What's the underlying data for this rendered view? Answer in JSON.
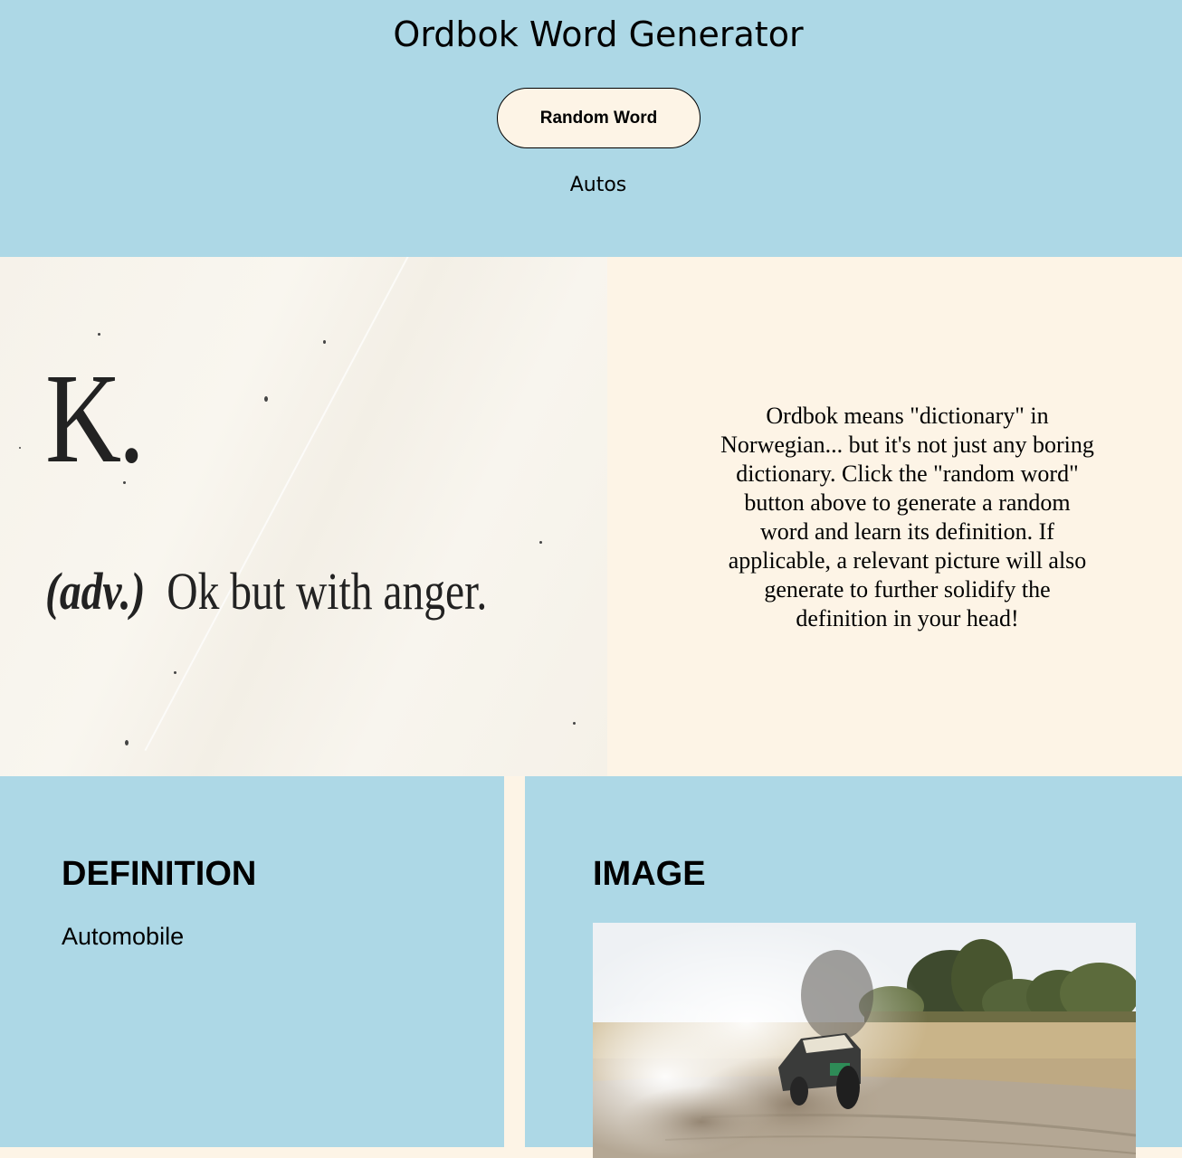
{
  "header": {
    "title": "Ordbok Word Generator",
    "button_label": "Random Word",
    "current_word": "Autos"
  },
  "hero": {
    "image": {
      "letter": "K.",
      "part_of_speech": "(adv.)",
      "definition": "Ok but with anger."
    },
    "description": "Ordbok means \"dictionary\" in Norwegian... but it's not just any boring dictionary. Click the \"random word\" button above to generate a random word and learn its definition. If applicable, a relevant picture will also generate to further solidify the definition in your head!"
  },
  "definition_panel": {
    "heading": "DEFINITION",
    "text": "Automobile"
  },
  "image_panel": {
    "heading": "IMAGE"
  },
  "colors": {
    "panel_blue": "#add8e6",
    "cream": "#fdf4e6",
    "text": "#000000"
  }
}
